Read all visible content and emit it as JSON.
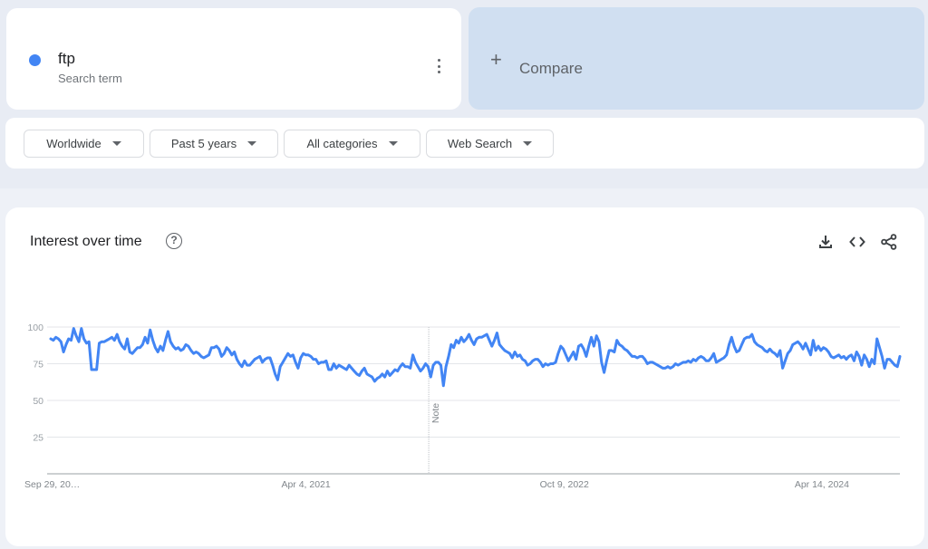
{
  "search_term": {
    "name": "ftp",
    "subtitle": "Search term",
    "color": "#4285f4",
    "menu_icon": "more-vert-icon"
  },
  "compare": {
    "icon": "plus-icon",
    "label": "Compare"
  },
  "filters": [
    {
      "label": "Worldwide"
    },
    {
      "label": "Past 5 years"
    },
    {
      "label": "All categories"
    },
    {
      "label": "Web Search"
    }
  ],
  "widget": {
    "title": "Interest over time",
    "help_icon": "?",
    "actions": [
      "download-icon",
      "embed-icon",
      "share-icon"
    ]
  },
  "chart_data": {
    "type": "line",
    "title": "Interest over time",
    "xlabel": "",
    "ylabel": "",
    "ylim": [
      0,
      100
    ],
    "yticks": [
      25,
      50,
      75,
      100
    ],
    "grid": true,
    "x_tick_labels": [
      "Sep 29, 20…",
      "Apr 4, 2021",
      "Oct 9, 2022",
      "Apr 14, 2024"
    ],
    "x_tick_positions": [
      0,
      0.3035,
      0.6065,
      0.9085
    ],
    "note_position": 0.4475,
    "note_label": "Note",
    "series": [
      {
        "name": "ftp",
        "color": "#4285f4",
        "values": [
          92,
          91,
          93,
          92,
          90,
          83,
          88,
          92,
          91,
          99,
          94,
          90,
          99,
          92,
          89,
          90,
          71,
          71,
          71,
          89,
          90,
          90,
          91,
          92,
          93,
          91,
          95,
          90,
          87,
          85,
          92,
          83,
          82,
          84,
          86,
          86,
          88,
          93,
          89,
          98,
          91,
          86,
          83,
          87,
          84,
          91,
          97,
          90,
          87,
          85,
          86,
          84,
          85,
          88,
          87,
          84,
          82,
          83,
          82,
          80,
          79,
          80,
          81,
          86,
          86,
          87,
          85,
          80,
          82,
          86,
          84,
          81,
          83,
          78,
          75,
          73,
          77,
          74,
          74,
          76,
          78,
          79,
          80,
          76,
          78,
          79,
          79,
          74,
          68,
          64,
          73,
          76,
          79,
          82,
          80,
          81,
          76,
          72,
          79,
          82,
          81,
          81,
          80,
          78,
          78,
          75,
          76,
          76,
          77,
          71,
          71,
          75,
          72,
          74,
          73,
          72,
          71,
          74,
          72,
          70,
          68,
          67,
          70,
          72,
          68,
          67,
          66,
          63,
          65,
          66,
          68,
          66,
          70,
          67,
          69,
          71,
          70,
          73,
          75,
          73,
          73,
          72,
          81,
          76,
          73,
          70,
          72,
          75,
          73,
          66,
          74,
          76,
          76,
          74,
          60,
          73,
          80,
          88,
          86,
          91,
          89,
          93,
          90,
          92,
          95,
          91,
          88,
          92,
          93,
          93,
          94,
          95,
          91,
          87,
          91,
          96,
          88,
          86,
          84,
          83,
          82,
          79,
          83,
          80,
          81,
          78,
          77,
          74,
          75,
          77,
          78,
          78,
          76,
          73,
          75,
          74,
          75,
          75,
          76,
          82,
          87,
          85,
          81,
          77,
          80,
          83,
          78,
          87,
          88,
          85,
          80,
          87,
          93,
          87,
          94,
          90,
          76,
          69,
          77,
          84,
          84,
          83,
          91,
          88,
          87,
          85,
          84,
          82,
          80,
          80,
          79,
          80,
          80,
          78,
          75,
          76,
          76,
          75,
          74,
          73,
          72,
          72,
          73,
          72,
          73,
          75,
          74,
          75,
          76,
          76,
          77,
          76,
          78,
          77,
          79,
          80,
          79,
          77,
          77,
          79,
          82,
          76,
          77,
          78,
          79,
          81,
          88,
          93,
          87,
          83,
          84,
          88,
          92,
          93,
          93,
          95,
          90,
          88,
          87,
          86,
          84,
          83,
          85,
          83,
          82,
          80,
          84,
          72,
          77,
          82,
          84,
          88,
          89,
          90,
          88,
          85,
          89,
          85,
          81,
          91,
          84,
          87,
          84,
          86,
          85,
          83,
          80,
          79,
          80,
          81,
          79,
          80,
          78,
          80,
          81,
          77,
          83,
          80,
          74,
          81,
          78,
          73,
          78,
          75,
          92,
          86,
          80,
          72,
          78,
          78,
          76,
          74,
          73,
          80
        ]
      }
    ]
  }
}
